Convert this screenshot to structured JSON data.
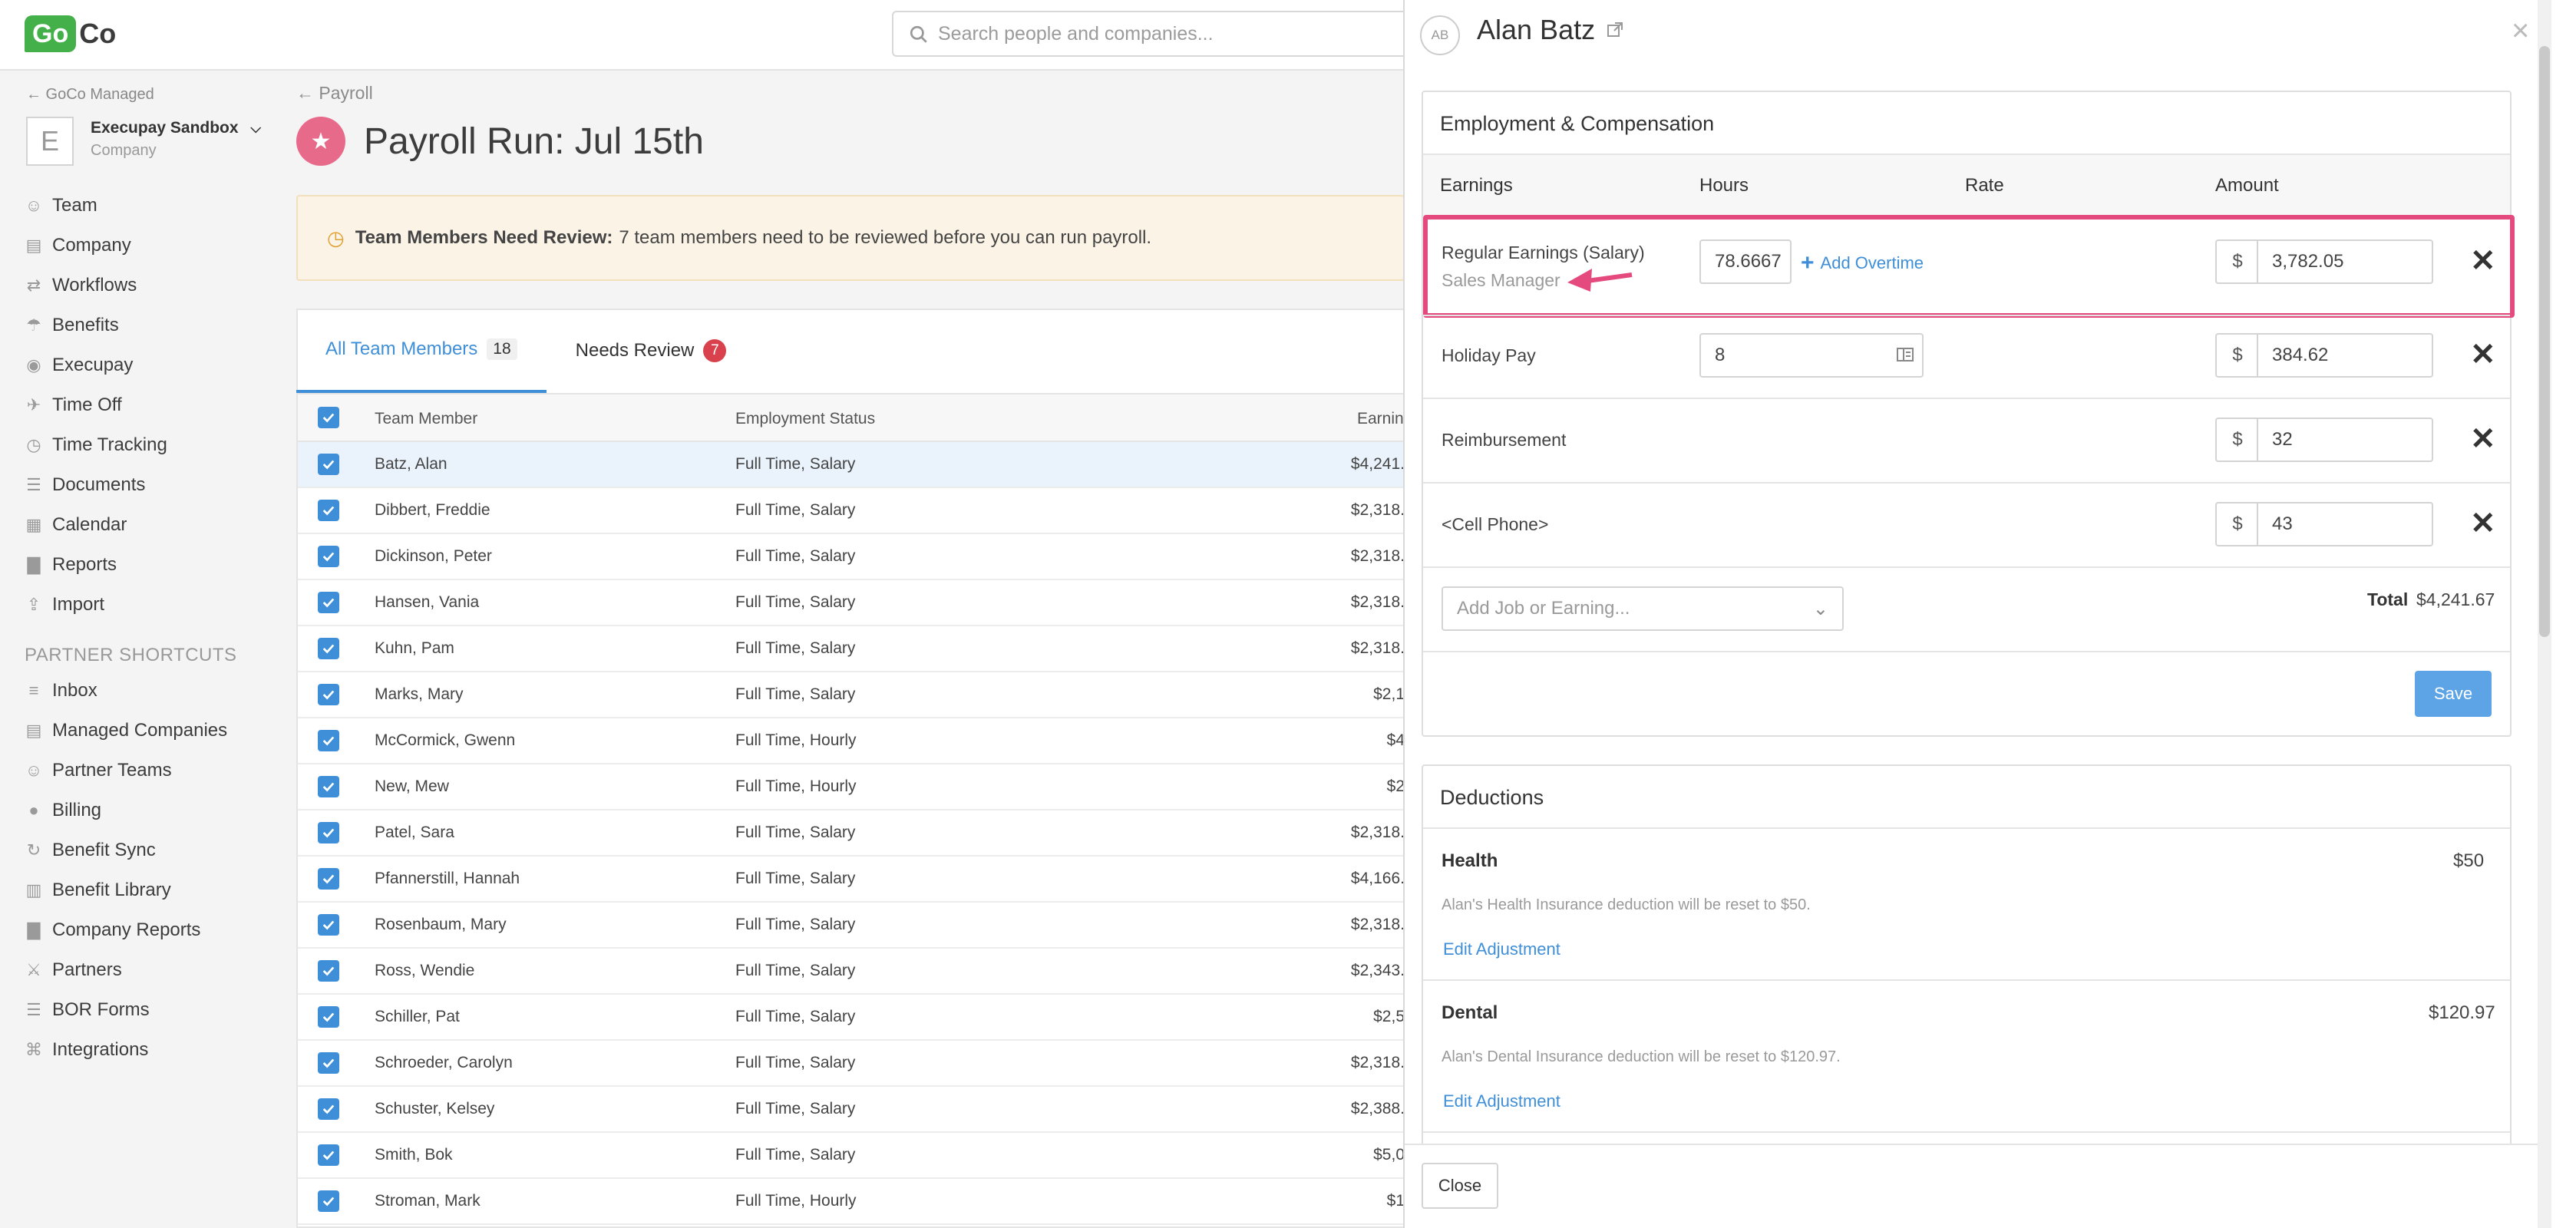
{
  "app": {
    "logo_go": "Go",
    "logo_co": "Co",
    "search_placeholder": "Search people and companies..."
  },
  "sidebar": {
    "managed": "← GoCo Managed",
    "company_initial": "E",
    "company_name": "Execupay Sandbox",
    "company_sub": "Company",
    "items": [
      {
        "label": "Team",
        "icon": "people-icon"
      },
      {
        "label": "Company",
        "icon": "building-icon"
      },
      {
        "label": "Workflows",
        "icon": "flow-icon"
      },
      {
        "label": "Benefits",
        "icon": "umbrella-icon"
      },
      {
        "label": "Execupay",
        "icon": "bag-icon"
      },
      {
        "label": "Time Off",
        "icon": "plane-icon"
      },
      {
        "label": "Time Tracking",
        "icon": "clock-icon"
      },
      {
        "label": "Documents",
        "icon": "document-icon"
      },
      {
        "label": "Calendar",
        "icon": "calendar-icon"
      },
      {
        "label": "Reports",
        "icon": "chart-icon"
      },
      {
        "label": "Import",
        "icon": "upload-icon"
      }
    ],
    "section": "PARTNER SHORTCUTS",
    "partner_items": [
      {
        "label": "Inbox",
        "icon": "list-icon"
      },
      {
        "label": "Managed Companies",
        "icon": "building-icon"
      },
      {
        "label": "Partner Teams",
        "icon": "people-icon"
      },
      {
        "label": "Billing",
        "icon": "dollar-icon"
      },
      {
        "label": "Benefit Sync",
        "icon": "sync-icon"
      },
      {
        "label": "Benefit Library",
        "icon": "book-icon"
      },
      {
        "label": "Company Reports",
        "icon": "chart-icon"
      },
      {
        "label": "Partners",
        "icon": "handshake-icon"
      },
      {
        "label": "BOR Forms",
        "icon": "document-icon"
      },
      {
        "label": "Integrations",
        "icon": "integrations-icon"
      }
    ]
  },
  "main": {
    "breadcrumb": "← Payroll",
    "title": "Payroll Run: Jul 15th",
    "alert_bold": "Team Members Need Review:",
    "alert_text": "7 team members need to be reviewed before you can run payroll.",
    "tabs": [
      {
        "label": "All Team Members",
        "count": "18"
      },
      {
        "label": "Needs Review",
        "count": "7"
      }
    ],
    "columns": [
      "Team Member",
      "Employment Status",
      "Earnin"
    ],
    "rows": [
      {
        "name": "Batz, Alan",
        "status": "Full Time, Salary",
        "earn": "$4,241."
      },
      {
        "name": "Dibbert, Freddie",
        "status": "Full Time, Salary",
        "earn": "$2,318."
      },
      {
        "name": "Dickinson, Peter",
        "status": "Full Time, Salary",
        "earn": "$2,318."
      },
      {
        "name": "Hansen, Vania",
        "status": "Full Time, Salary",
        "earn": "$2,318."
      },
      {
        "name": "Kuhn, Pam",
        "status": "Full Time, Salary",
        "earn": "$2,318."
      },
      {
        "name": "Marks, Mary",
        "status": "Full Time, Salary",
        "earn": "$2,1"
      },
      {
        "name": "McCormick, Gwenn",
        "status": "Full Time, Hourly",
        "earn": "$4"
      },
      {
        "name": "New, Mew",
        "status": "Full Time, Hourly",
        "earn": "$2"
      },
      {
        "name": "Patel, Sara",
        "status": "Full Time, Salary",
        "earn": "$2,318."
      },
      {
        "name": "Pfannerstill, Hannah",
        "status": "Full Time, Salary",
        "earn": "$4,166."
      },
      {
        "name": "Rosenbaum, Mary",
        "status": "Full Time, Salary",
        "earn": "$2,318."
      },
      {
        "name": "Ross, Wendie",
        "status": "Full Time, Salary",
        "earn": "$2,343."
      },
      {
        "name": "Schiller, Pat",
        "status": "Full Time, Salary",
        "earn": "$2,5"
      },
      {
        "name": "Schroeder, Carolyn",
        "status": "Full Time, Salary",
        "earn": "$2,318."
      },
      {
        "name": "Schuster, Kelsey",
        "status": "Full Time, Salary",
        "earn": "$2,388."
      },
      {
        "name": "Smith, Bok",
        "status": "Full Time, Salary",
        "earn": "$5,0"
      },
      {
        "name": "Stroman, Mark",
        "status": "Full Time, Hourly",
        "earn": "$1"
      }
    ]
  },
  "drawer": {
    "initials": "AB",
    "name": "Alan Batz",
    "panel_title": "Employment & Compensation",
    "cols": {
      "earnings": "Earnings",
      "hours": "Hours",
      "rate": "Rate",
      "amount": "Amount"
    },
    "earnings": [
      {
        "label": "Regular Earnings (Salary)",
        "sub": "Sales Manager",
        "hours": "78.6667",
        "amount": "3,782.05",
        "link": "Add Overtime"
      },
      {
        "label": "Holiday Pay",
        "hours": "8",
        "amount": "384.62"
      },
      {
        "label": "Reimbursement",
        "amount": "32"
      },
      {
        "label": "<Cell Phone>",
        "amount": "43"
      }
    ],
    "currency": "$",
    "add_placeholder": "Add Job or Earning...",
    "total_label": "Total",
    "total_value": "$4,241.67",
    "save": "Save",
    "deductions_title": "Deductions",
    "deductions": [
      {
        "label": "Health",
        "value": "$50",
        "note": "Alan's Health Insurance deduction will be reset to $50.",
        "link": "Edit Adjustment"
      },
      {
        "label": "Dental",
        "value": "$120.97",
        "note": "Alan's Dental Insurance deduction will be reset to $120.97.",
        "link": "Edit Adjustment"
      }
    ],
    "close": "Close",
    "close_x": "×"
  },
  "colors": {
    "accent": "#3f8fd8",
    "highlight": "#e44a7e",
    "logo": "#43b049",
    "badge": "#d9414c"
  }
}
